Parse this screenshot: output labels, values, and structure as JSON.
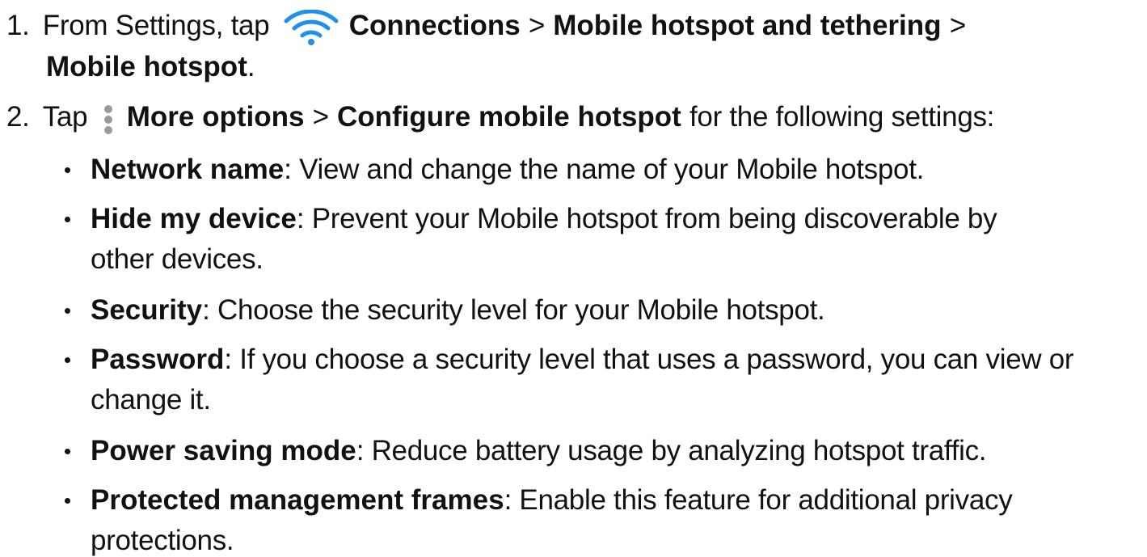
{
  "steps": [
    {
      "number": "1.",
      "prefix": "From Settings, tap",
      "icon": "wifi-icon",
      "path_1": "Connections",
      "sep_1": ">",
      "path_2": "Mobile hotspot and tethering",
      "sep_2": ">",
      "path_3": "Mobile hotspot",
      "suffix": "."
    },
    {
      "number": "2.",
      "prefix": "Tap",
      "icon": "more-options-icon",
      "path_1": "More options",
      "sep_1": ">",
      "path_2": "Configure mobile hotspot",
      "suffix": "for the following settings:"
    }
  ],
  "settings": [
    {
      "term": "Network name",
      "desc_1": ": View and change the name of your Mobile hotspot.",
      "desc_2": ""
    },
    {
      "term": "Hide my device",
      "desc_1": ": Prevent your Mobile hotspot from being discoverable by",
      "desc_2": "other devices."
    },
    {
      "term": "Security",
      "desc_1": ": Choose the security level for your Mobile hotspot.",
      "desc_2": ""
    },
    {
      "term": "Password",
      "desc_1": ": If you choose a security level that uses a password, you can view or",
      "desc_2": "change it."
    },
    {
      "term": "Power saving mode",
      "desc_1": ": Reduce battery usage by analyzing hotspot traffic.",
      "desc_2": ""
    },
    {
      "term": "Protected management frames",
      "desc_1": ": Enable this feature for additional privacy",
      "desc_2": "protections."
    }
  ],
  "colors": {
    "text": "#111111",
    "icon_accent": "#1e90f0",
    "icon_gray": "#9a9a9a"
  }
}
